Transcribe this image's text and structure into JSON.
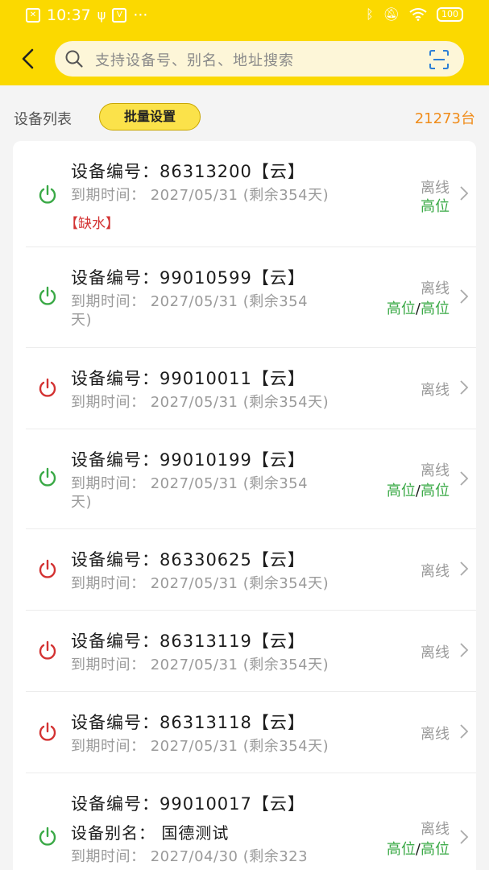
{
  "status_bar": {
    "time": "10:37",
    "dots": "···",
    "battery": "100",
    "icons": [
      "sim-icon",
      "usb-icon",
      "vpn-icon",
      "bluetooth-icon",
      "mute-icon",
      "wifi-icon",
      "battery-icon"
    ]
  },
  "search": {
    "placeholder": "支持设备号、别名、地址搜索",
    "icons": [
      "back-arrow-icon",
      "search-icon",
      "scan-icon"
    ]
  },
  "list": {
    "title": "设备列表",
    "batch_button": "批量设置",
    "count": "21273台"
  },
  "colors": {
    "header": "#fbd900",
    "online_power": "#3aa946",
    "offline_power": "#d33232",
    "level": "#3aa946",
    "count": "#f08c1a",
    "warning": "#d33232"
  },
  "devices": [
    {
      "title": "设备编号：86313200【云】",
      "expiry_line1": "到期时间：  2027/05/31 (剩余354天)",
      "expiry_line2": "",
      "warning": "【缺水】",
      "status": "离线",
      "level_a": "高位",
      "level_sep": "",
      "level_b": "",
      "power": "green"
    },
    {
      "title": "设备编号：99010599【云】",
      "expiry_line1": "到期时间：  2027/05/31 (剩余354",
      "expiry_line2": "天)",
      "status": "离线",
      "level_a": "高位",
      "level_sep": "/",
      "level_b": "高位",
      "power": "green"
    },
    {
      "title": "设备编号：99010011【云】",
      "expiry_line1": "到期时间：  2027/05/31 (剩余354天)",
      "expiry_line2": "",
      "status": "离线",
      "power": "red"
    },
    {
      "title": "设备编号：99010199【云】",
      "expiry_line1": "到期时间：  2027/05/31 (剩余354",
      "expiry_line2": "天)",
      "status": "离线",
      "level_a": "高位",
      "level_sep": "/",
      "level_b": "高位",
      "power": "green"
    },
    {
      "title": "设备编号：86330625【云】",
      "expiry_line1": "到期时间：  2027/05/31 (剩余354天)",
      "expiry_line2": "",
      "status": "离线",
      "power": "red"
    },
    {
      "title": "设备编号：86313119【云】",
      "expiry_line1": "到期时间：  2027/05/31 (剩余354天)",
      "expiry_line2": "",
      "status": "离线",
      "power": "red"
    },
    {
      "title": "设备编号：86313118【云】",
      "expiry_line1": "到期时间：  2027/05/31 (剩余354天)",
      "expiry_line2": "",
      "status": "离线",
      "power": "red"
    },
    {
      "title": "设备编号：99010017【云】",
      "alias": "设备别名：  国德测试",
      "expiry_line1": "到期时间：  2027/04/30 (剩余323",
      "expiry_line2": "",
      "status": "离线",
      "level_a": "高位",
      "level_sep": "/",
      "level_b": "高位",
      "power": "green"
    }
  ]
}
